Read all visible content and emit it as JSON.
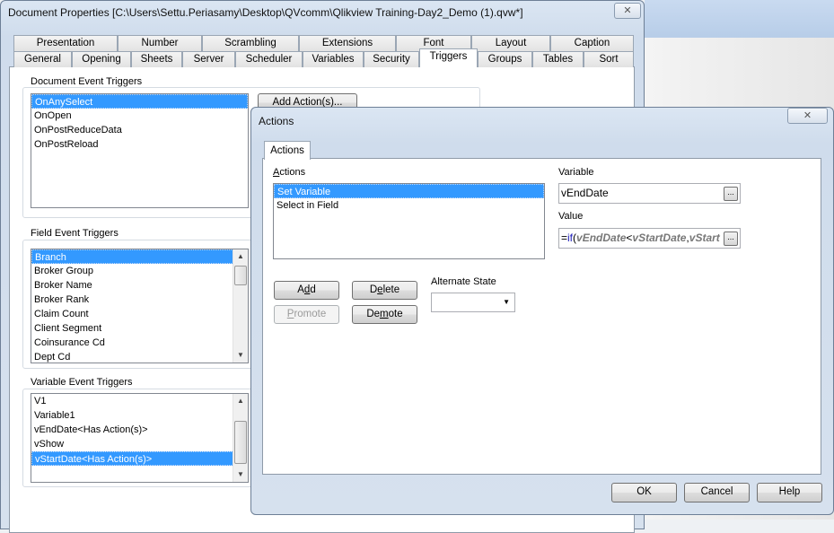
{
  "main_window": {
    "title": "Document Properties [C:\\Users\\Settu.Periasamy\\Desktop\\QVcomm\\Qlikview Training-Day2_Demo (1).qvw*]",
    "close_icon": "close-x-icon",
    "tabs_row1": [
      "Presentation",
      "Number",
      "Scrambling",
      "Extensions",
      "Font",
      "Layout",
      "Caption"
    ],
    "tabs_row2": [
      "General",
      "Opening",
      "Sheets",
      "Server",
      "Scheduler",
      "Variables",
      "Security",
      "Triggers",
      "Groups",
      "Tables",
      "Sort"
    ],
    "selected_tab": "Triggers",
    "document_event_triggers": {
      "label": "Document Event Triggers",
      "items": [
        "OnAnySelect",
        "OnOpen",
        "OnPostReduceData",
        "OnPostReload"
      ],
      "selected": "OnAnySelect",
      "add_button": "Add Action(s)..."
    },
    "field_event_triggers": {
      "label": "Field Event Triggers",
      "items": [
        "Branch",
        "Broker Group",
        "Broker Name",
        "Broker Rank",
        "Claim Count",
        "Client Segment",
        "Coinsurance Cd",
        "Dept Cd"
      ],
      "selected": "Branch"
    },
    "variable_event_triggers": {
      "label": "Variable Event Triggers",
      "items": [
        "V1",
        "Variable1",
        "vEndDate<Has Action(s)>",
        "vShow",
        "vStartDate<Has Action(s)>"
      ],
      "selected": "vStartDate<Has Action(s)>"
    }
  },
  "actions_dialog": {
    "title": "Actions",
    "tab": "Actions",
    "actions_label": "Actions",
    "actions": [
      "Set Variable",
      "Select in Field"
    ],
    "selected_action": "Set Variable",
    "variable_label": "Variable",
    "variable_value": "vEndDate",
    "value_label": "Value",
    "value_parts": {
      "eq": "=",
      "fn": "if",
      "open": "(",
      "a": "vEndDate",
      "lt": "<",
      "b": "vStartDate",
      "comma": ",",
      "c": "vStart"
    },
    "ellipsis": "...",
    "buttons": {
      "add": "Add",
      "delete": "Delete",
      "promote": "Promote",
      "demote": "Demote",
      "ok": "OK",
      "cancel": "Cancel",
      "help": "Help"
    },
    "alternate_state_label": "Alternate State",
    "alternate_state_value": ""
  }
}
